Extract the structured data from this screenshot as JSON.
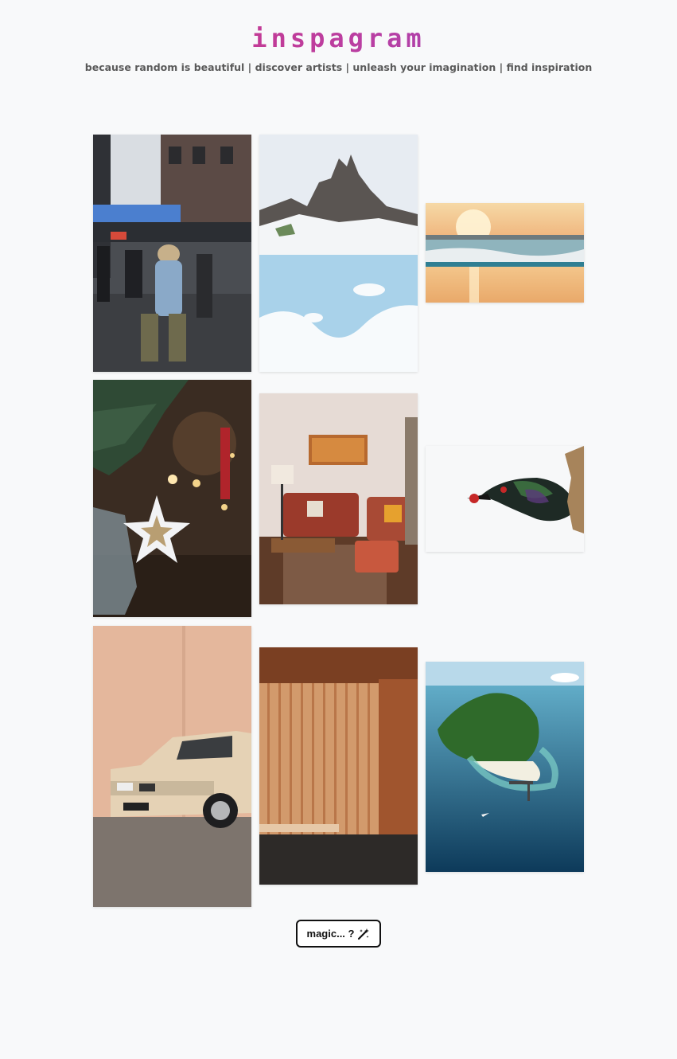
{
  "header": {
    "logo": "inspagram",
    "tagline": "because random is beautiful | discover artists | unleash your imagination | find inspiration"
  },
  "gallery": [
    {
      "subject": "city street with pedestrians"
    },
    {
      "subject": "snowy mountain peak and frozen lake"
    },
    {
      "subject": "ocean waves at sunset"
    },
    {
      "subject": "christmas star ornament on fir branch"
    },
    {
      "subject": "retro living room with red sofa"
    },
    {
      "subject": "iridescent bird with red eye"
    },
    {
      "subject": "vintage beige car against peach wall"
    },
    {
      "subject": "wooden slatted interior"
    },
    {
      "subject": "aerial tropical island"
    }
  ],
  "magic_button": {
    "label": "magic... ?",
    "icon": "magic-wand-icon"
  }
}
